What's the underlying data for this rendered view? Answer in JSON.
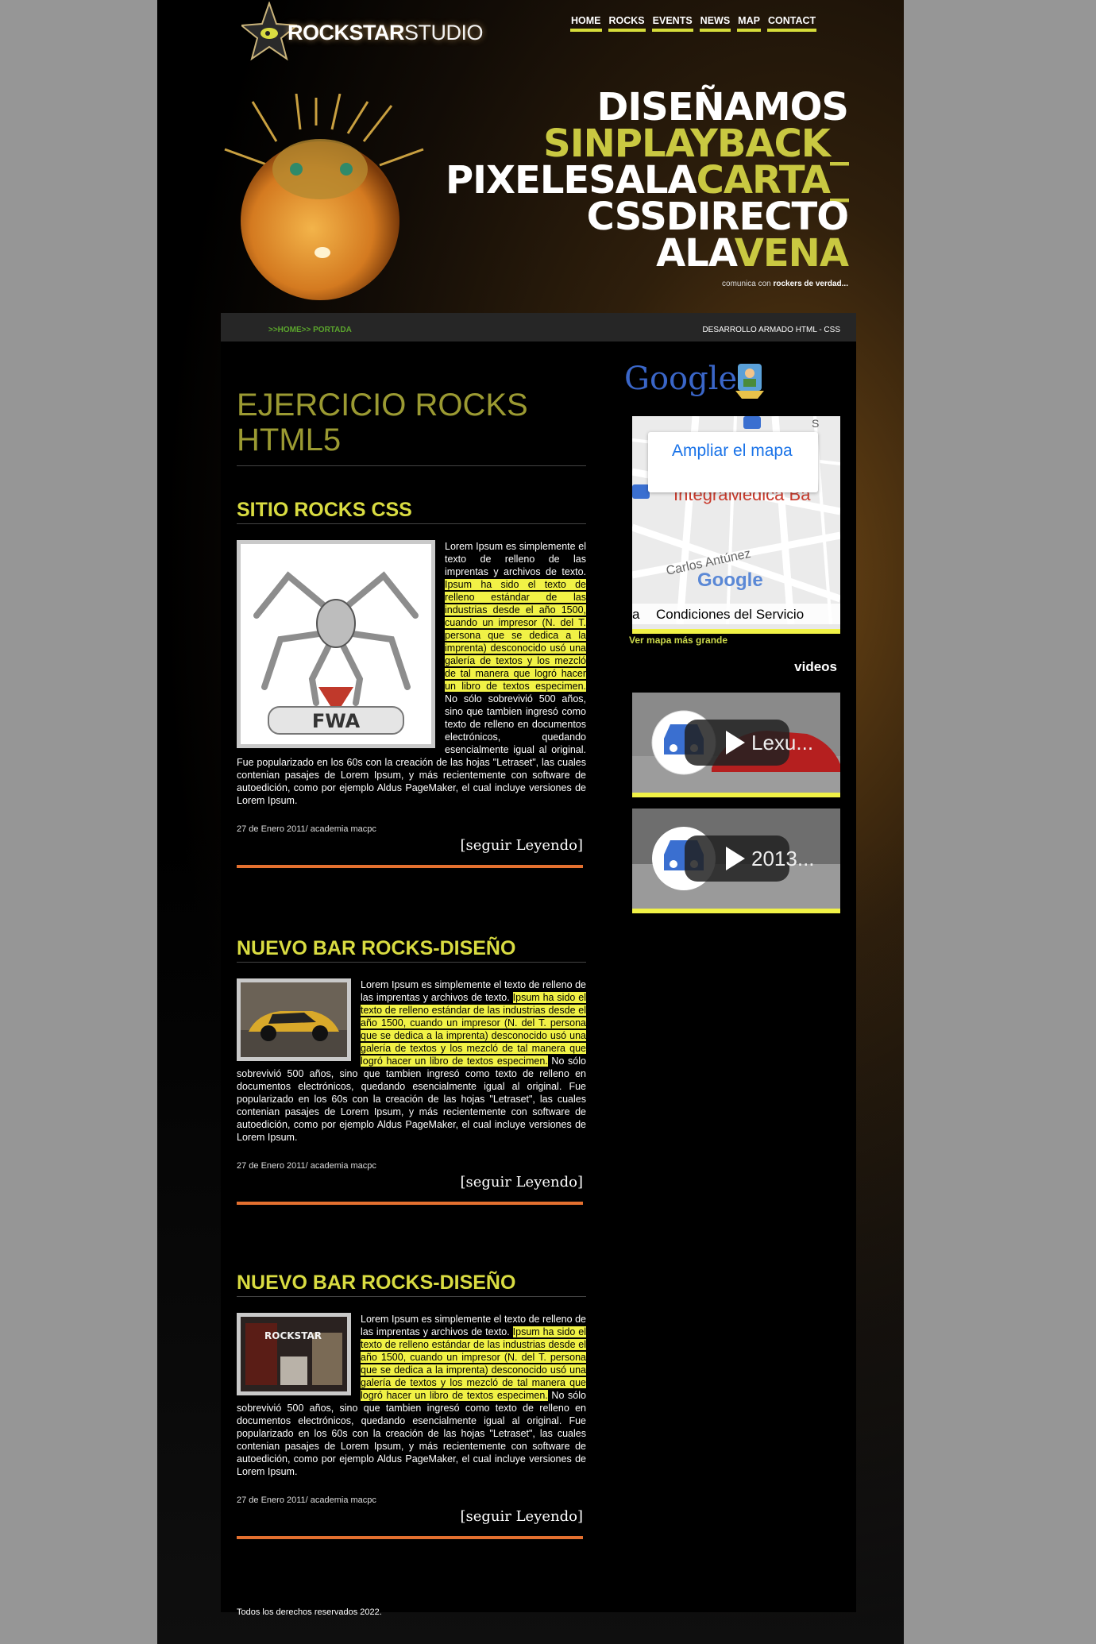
{
  "brand": {
    "logo_strong": "ROCKSTAR",
    "logo_light": "STUDIO"
  },
  "nav": [
    {
      "label": "HOME"
    },
    {
      "label": "ROCKS"
    },
    {
      "label": "EVENTS"
    },
    {
      "label": "NEWS"
    },
    {
      "label": "MAP"
    },
    {
      "label": "CONTACT"
    }
  ],
  "hero": {
    "line1": "DISEÑAMOS",
    "line2": "SINPLAYBACK_",
    "line3_white": "PIXELESALA",
    "line3_yellow": "CARTA_",
    "line4": "CSSDIRECTO",
    "line5_white": "ALA",
    "line5_yellow": "VENA",
    "tag_light": "comunica con",
    "tag_bold": "rockers de verdad..."
  },
  "breadcrumb": {
    "path": ">>HOME>>   PORTADA",
    "right": "DESARROLLO ARMADO HTML - CSS"
  },
  "main_title": "EJERCICIO ROCKS HTML5",
  "articles": [
    {
      "title": "SITIO ROCKS CSS",
      "intro": "Lorem Ipsum es simplemente el texto de relleno de las imprentas y archivos de texto. ",
      "highlight": "Ipsum ha sido el texto de relleno estándar de las industrias desde el año 1500, cuando un impresor (N. del T. persona que se dedica a la imprenta) desconocido usó una galería de textos y los mezcló de tal manera que logró hacer un libro de textos especimen.",
      "rest": " No sólo sobrevivió 500 años, sino que tambien ingresó como texto de relleno en documentos electrónicos, quedando esencialmente igual al original. Fue popularizado en los 60s con la creación de las hojas \"Letraset\", las cuales contenian pasajes de Lorem Ipsum, y más recientemente con software de autoedición, como por ejemplo Aldus PageMaker, el cual incluye versiones de Lorem Ipsum.",
      "date": "27 de Enero 2011/ academia macpc",
      "more": "[seguir Leyendo]",
      "image_label": "FWA"
    },
    {
      "title": "NUEVO BAR ROCKS-DISEÑO",
      "intro": "Lorem Ipsum es simplemente el texto de relleno de las imprentas y archivos de texto. ",
      "highlight": "Ipsum ha sido el texto de relleno estándar de las industrias desde el año 1500, cuando un impresor (N. del T. persona que se dedica a la imprenta) desconocido usó una galería de textos y los mezcló de tal manera que logró hacer un libro de textos especimen.",
      "rest": " No sólo sobrevivió 500 años, sino que tambien ingresó como texto de relleno en documentos electrónicos, quedando esencialmente igual al original. Fue popularizado en los 60s con la creación de las hojas \"Letraset\", las cuales contenian pasajes de Lorem Ipsum, y más recientemente con software de autoedición, como por ejemplo Aldus PageMaker, el cual incluye versiones de Lorem Ipsum.",
      "date": "27 de Enero 2011/ academia macpc",
      "more": "[seguir Leyendo]"
    },
    {
      "title": "NUEVO BAR ROCKS-DISEÑO",
      "intro": "Lorem Ipsum es simplemente el texto de relleno de las imprentas y archivos de texto. ",
      "highlight": "Ipsum ha sido el texto de relleno estándar de las industrias desde el año 1500, cuando un impresor (N. del T. persona que se dedica a la imprenta) desconocido usó una galería de textos y los mezcló de tal manera que logró hacer un libro de textos especimen.",
      "rest": " No sólo sobrevivió 500 años, sino que tambien ingresó como texto de relleno en documentos electrónicos, quedando esencialmente igual al original. Fue popularizado en los 60s con la creación de las hojas \"Letraset\", las cuales contenian pasajes de Lorem Ipsum, y más recientemente con software de autoedición, como por ejemplo Aldus PageMaker, el cual incluye versiones de Lorem Ipsum.",
      "date": "27 de Enero 2011/ academia macpc",
      "more": "[seguir Leyendo]",
      "image_label": "ROCKSTAR"
    }
  ],
  "sidebar": {
    "google_logo": "Google",
    "map": {
      "expand": "Ampliar el mapa",
      "place": "IntegraMédica Ba",
      "street": "Carlos Antúnez",
      "watermark": "Google",
      "terms": "Condiciones del Servicio",
      "corner_left": "a",
      "top_right": "S"
    },
    "map_link": "Ver mapa más grande",
    "videos_title": "videos",
    "videos": [
      {
        "label": "Lexu..."
      },
      {
        "label": "2013..."
      }
    ]
  },
  "footer": "Todos los derechos reservados 2022.",
  "colors": {
    "accent_yellow": "#d9dc41",
    "highlight": "#f1f246",
    "separator": "#e4702f",
    "crumb_green": "#5ba52d"
  }
}
